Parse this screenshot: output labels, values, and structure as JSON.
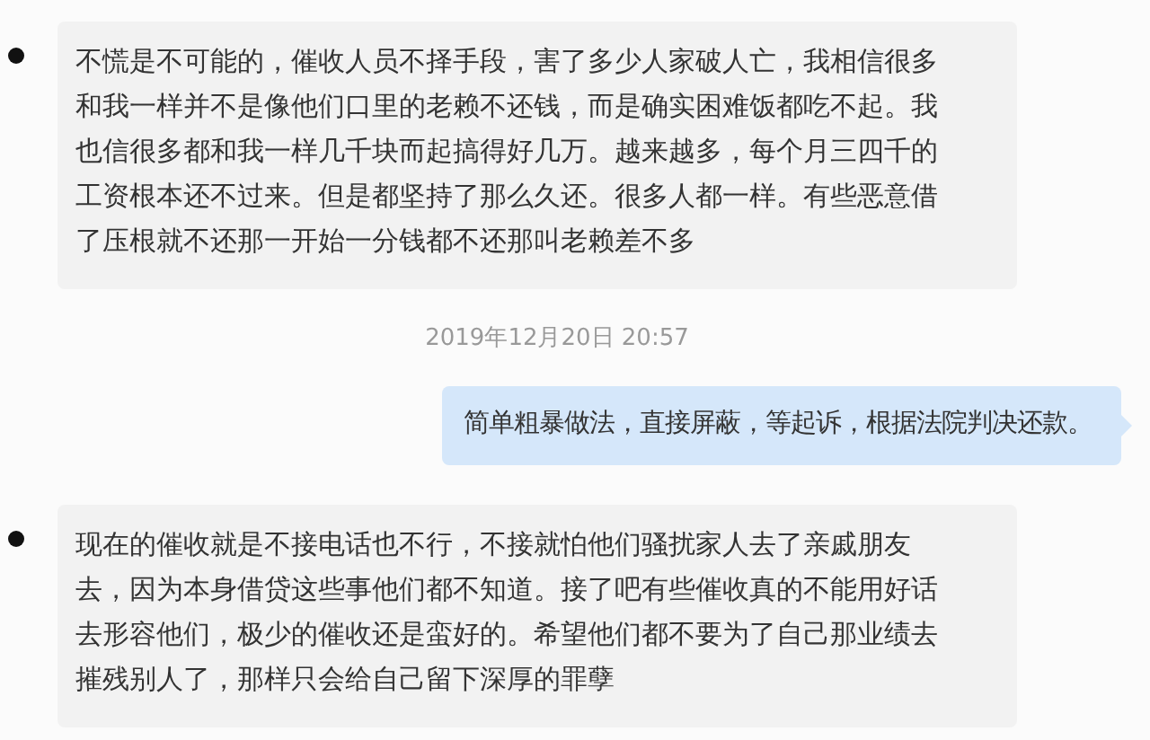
{
  "messages": [
    {
      "kind": "received",
      "text": "不慌是不可能的，催收人员不择手段，害了多少人家破人亡，我相信很多和我一样并不是像他们口里的老赖不还钱，而是确实困难饭都吃不起。我也信很多都和我一样几千块而起搞得好几万。越来越多，每个月三四千的工资根本还不过来。但是都坚持了那么久还。很多人都一样。有些恶意借了压根就不还那一开始一分钱都不还那叫老赖差不多"
    },
    {
      "kind": "time",
      "text": "2019年12月20日 20:57"
    },
    {
      "kind": "sent",
      "text": "简单粗暴做法，直接屏蔽，等起诉，根据法院判决还款。"
    },
    {
      "kind": "received",
      "text": "现在的催收就是不接电话也不行，不接就怕他们骚扰家人去了亲戚朋友去，因为本身借贷这些事他们都不知道。接了吧有些催收真的不能用好话去形容他们，极少的催收还是蛮好的。希望他们都不要为了自己那业绩去摧残别人了，那样只会给自己留下深厚的罪孽"
    }
  ]
}
